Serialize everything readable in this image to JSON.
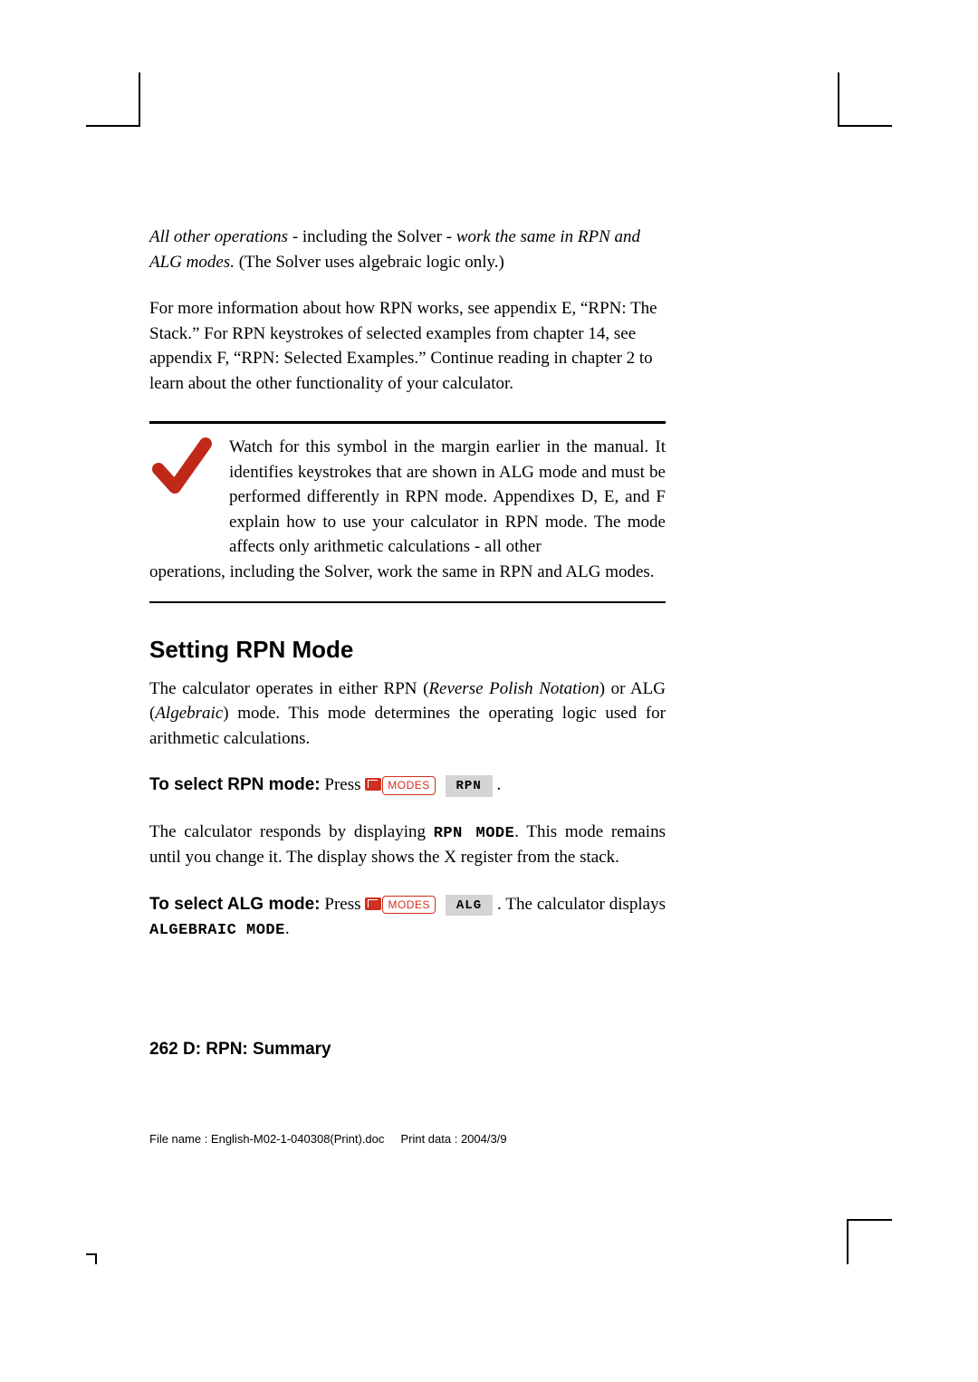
{
  "p1": {
    "a": "All other operations",
    "b": " - including the Solver - ",
    "c": "work the same in RPN and ALG modes.",
    "d": " (The Solver uses algebraic logic only.)"
  },
  "p2": "For more information about how RPN works, see appendix E, “RPN: The Stack.” For RPN keystrokes of selected examples from chapter 14, see appendix F, “RPN: Selected Examples.” Continue reading in chapter 2 to learn about the other functionality of your calculator.",
  "note1": "Watch for this symbol in the margin earlier in the manual. It identifies keystrokes that are shown in ALG mode and must be performed differently in RPN mode. Appendixes D, E, and F explain how to use your calculator in RPN mode. The mode affects only arithmetic calculations - all other ",
  "note2": "operations, including the Solver, work the same in RPN and ALG modes.",
  "h2": "Setting RPN Mode",
  "p3a": "The calculator operates in either RPN (",
  "p3b": "Reverse Polish Notation",
  "p3c": ") or ALG (",
  "p3d": "Algebraic",
  "p3e": ") mode. This mode determines the operating logic used for arithmetic calculations.",
  "rpn": {
    "label": "To select RPN mode:",
    "press": " Press ",
    "key1": "MODES",
    "menu": "RPN",
    "end": " ."
  },
  "p4a": "The calculator responds by displaying ",
  "p4b": "RPN MODE",
  "p4c": ". This mode remains until you change it. The display shows the X register from the stack.",
  "alg": {
    "label": "To select ALG mode:",
    "press": " Press ",
    "key1": "MODES",
    "menu": "ALG",
    "mid": " . The calculator displays ",
    "disp": "ALGEBRAIC MODE",
    "end": "."
  },
  "footer": {
    "page": "262",
    "sep": "   ",
    "title": "D: RPN: Summary"
  },
  "meta": {
    "a": "File name : English-M02-1-040308(Print).doc",
    "b": "Print data : 2004/3/9"
  },
  "icons": {
    "check": "check-icon",
    "shift": "shift-key-icon"
  }
}
